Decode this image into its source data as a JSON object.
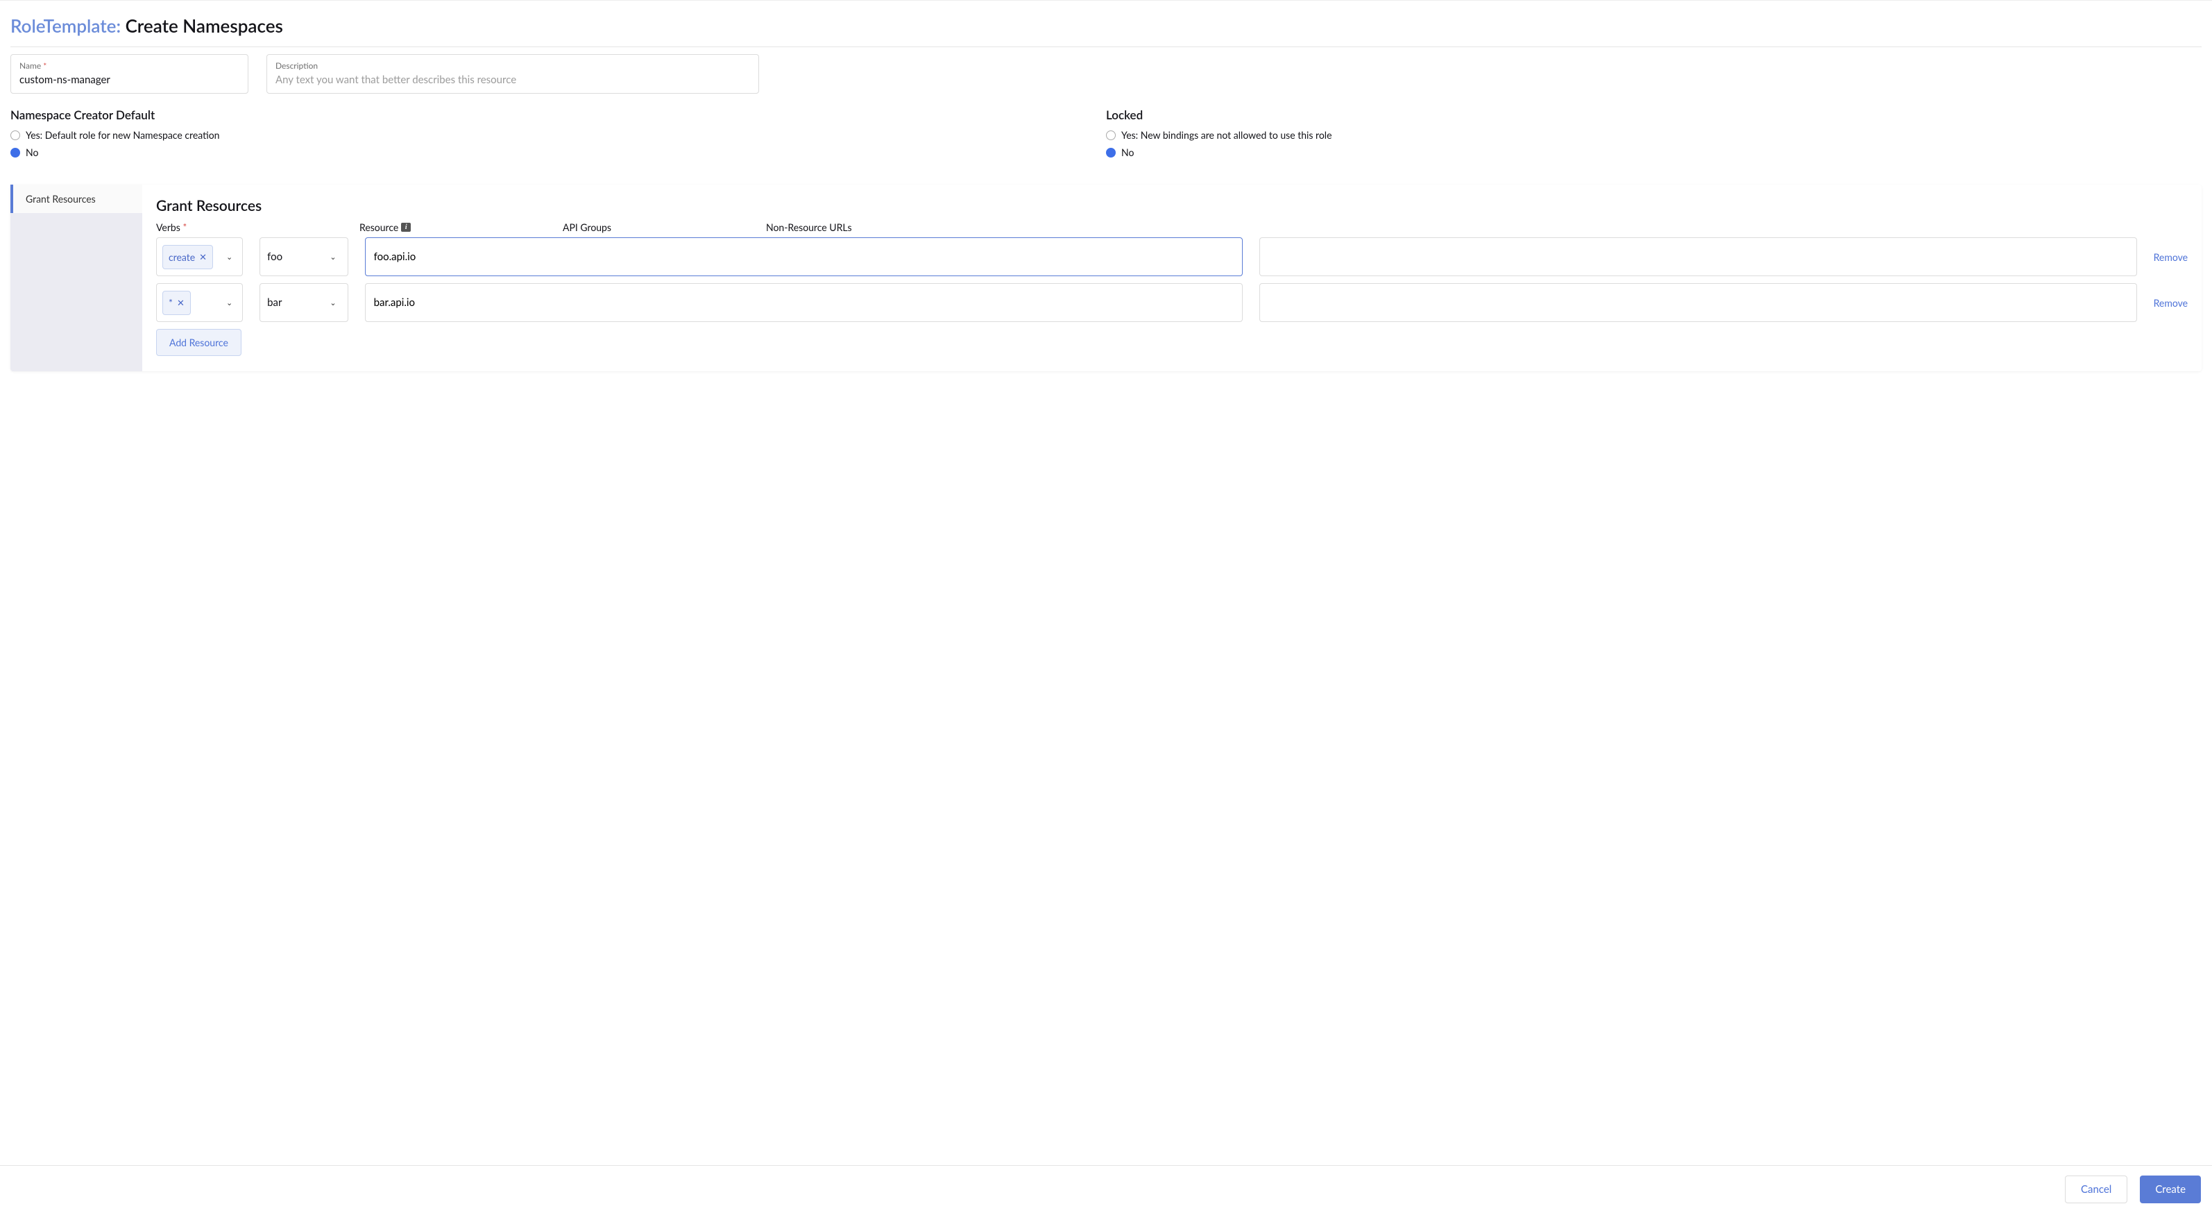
{
  "header": {
    "type_label": "RoleTemplate:",
    "title": "Create Namespaces"
  },
  "fields": {
    "name_label": "Name",
    "name_value": "custom-ns-manager",
    "desc_label": "Description",
    "desc_placeholder": "Any text you want that better describes this resource"
  },
  "ns_default": {
    "title": "Namespace Creator Default",
    "yes_label": "Yes: Default role for new Namespace creation",
    "no_label": "No"
  },
  "locked": {
    "title": "Locked",
    "yes_label": "Yes: New bindings are not allowed to use this role",
    "no_label": "No"
  },
  "tabs": {
    "grant_resources": "Grant Resources"
  },
  "grant": {
    "title": "Grant Resources",
    "col_verbs": "Verbs",
    "col_resource": "Resource",
    "col_api": "API Groups",
    "col_urls": "Non-Resource URLs",
    "rows": [
      {
        "verb_chip": "create",
        "resource": "foo",
        "api_group": "foo.api.io",
        "urls": "",
        "api_focused": true
      },
      {
        "verb_chip": "*",
        "resource": "bar",
        "api_group": "bar.api.io",
        "urls": "",
        "api_focused": false
      }
    ],
    "remove_label": "Remove",
    "add_label": "Add Resource"
  },
  "footer": {
    "cancel": "Cancel",
    "create": "Create"
  }
}
